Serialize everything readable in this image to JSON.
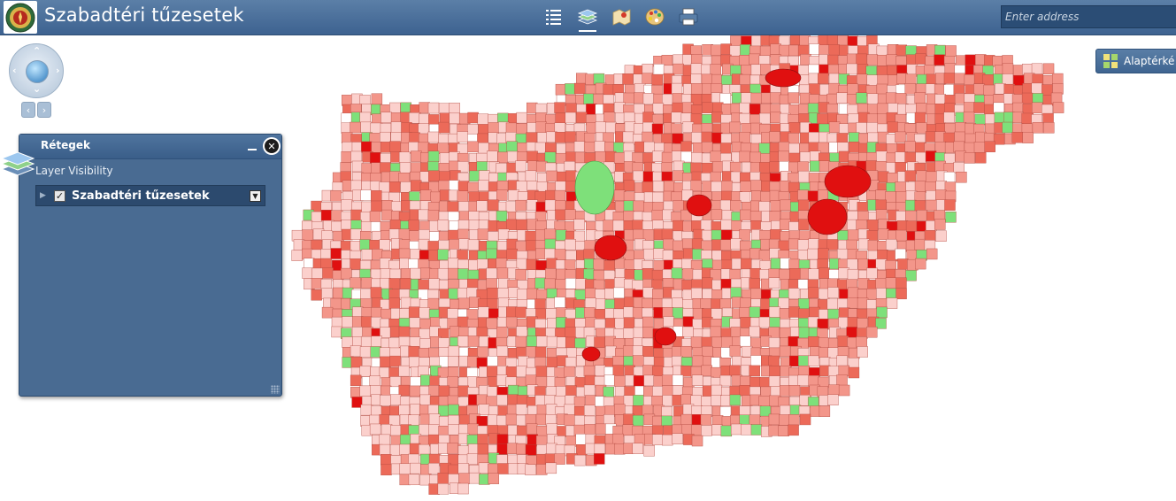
{
  "header": {
    "title": "Szabadtéri tűzesetek",
    "search_placeholder": "Enter address"
  },
  "toolbar": {
    "icons": [
      "legend-icon",
      "layers-icon",
      "map-notes-icon",
      "palette-icon",
      "print-icon"
    ],
    "active": "layers-icon"
  },
  "basemap": {
    "label": "Alaptérké"
  },
  "layers_panel": {
    "title": "Rétegek",
    "subtitle": "Layer Visibility",
    "layers": [
      {
        "name": "Szabadtéri tűzesetek",
        "visible": true
      }
    ]
  },
  "map": {
    "legend_colors": {
      "lowest": "#7ee07a",
      "low": "#fbd0cc",
      "medium": "#f3968a",
      "high": "#ec6a59",
      "highest": "#e01010"
    }
  }
}
